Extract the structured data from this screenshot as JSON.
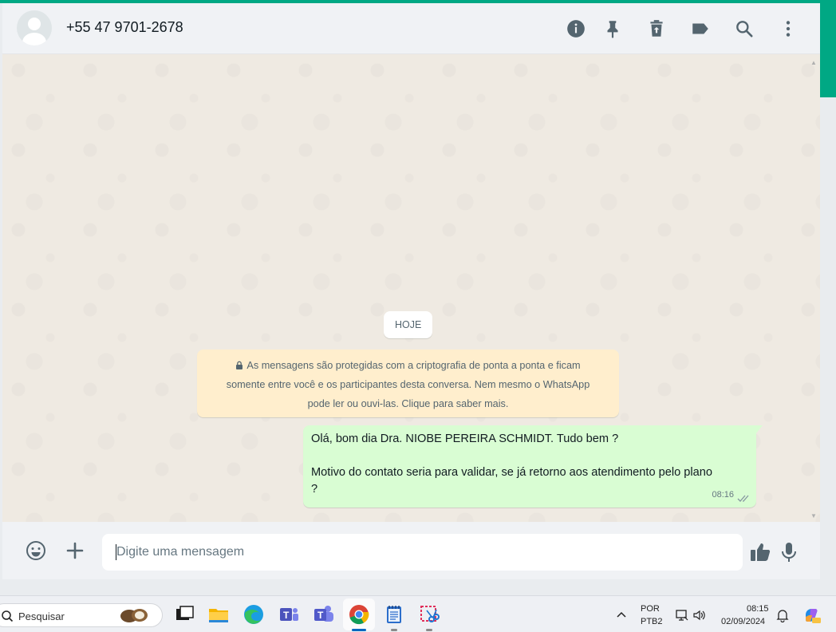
{
  "header": {
    "contact_name": "+55 47 9701-2678",
    "icons": [
      "info-icon",
      "pin-icon",
      "delete-icon",
      "label-icon",
      "search-icon",
      "menu-icon"
    ]
  },
  "chat": {
    "date_chip": "HOJE",
    "encryption_notice": {
      "line1": "As mensagens são protegidas com a criptografia de ponta a ponta e ficam",
      "line2": "somente entre você e os participantes desta conversa. Nem mesmo o WhatsApp",
      "line3": "pode ler ou ouvi-las. Clique para saber mais."
    },
    "messages": [
      {
        "direction": "outgoing",
        "line1": "Olá, bom dia Dra. NIOBE PEREIRA SCHMIDT. Tudo bem ?",
        "line2": "Motivo do contato seria para validar, se já retorno aos atendimento pelo plano",
        "line3": "?",
        "time": "08:16",
        "status": "delivered"
      }
    ]
  },
  "composer": {
    "placeholder": "Digite uma mensagem"
  },
  "taskbar": {
    "search_label": "Pesquisar",
    "language_top": "POR",
    "language_bottom": "PTB2",
    "clock_time": "08:15",
    "clock_date": "02/09/2024",
    "apps": [
      "task-view",
      "file-explorer",
      "edge",
      "teams-classic",
      "teams",
      "chrome",
      "notepad",
      "snipping-tool"
    ]
  },
  "colors": {
    "accent": "#00a884",
    "outgoing_bubble": "#d9fdd3",
    "notice_bg": "#ffeecd",
    "chat_bg": "#efeae2",
    "header_bg": "#f0f2f5"
  }
}
